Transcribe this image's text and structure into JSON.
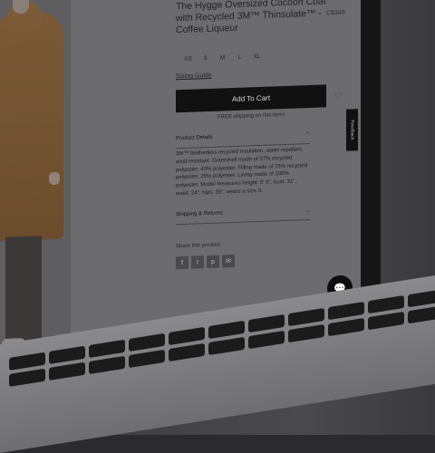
{
  "product": {
    "title": "The Hygge Oversized Cocoon Coat with Recycled 3M™ Thinsulate™ - Coffee Liqueur",
    "price": "C$349",
    "sizes": [
      "XS",
      "S",
      "M",
      "L",
      "XL"
    ],
    "sizing_guide": "Sizing Guide",
    "add_to_cart": "Add To Cart",
    "free_shipping": "FREE shipping on this item!",
    "details_heading": "Product Details",
    "details_text": "3M™ featherless recycled insulation, water repellent, wind resistant. Outershell made of 57% recycled polyester, 43% polyester. Filling made of 75% recycled polyester, 25% polyester. Lining made of 100% polyester. Model measures height: 5' 9\", bust: 31\", waist: 24\", hips: 35\"; wears a size S.",
    "shipping_heading": "Shipping & Returns",
    "share_label": "Share this product:",
    "share_buttons": [
      "f",
      "t",
      "p",
      "✉"
    ]
  },
  "feedback_tab": "Feedback",
  "icons": {
    "heart": "♡",
    "chevron_up": "⌃",
    "chevron_down": "⌄",
    "chat": "💬"
  }
}
